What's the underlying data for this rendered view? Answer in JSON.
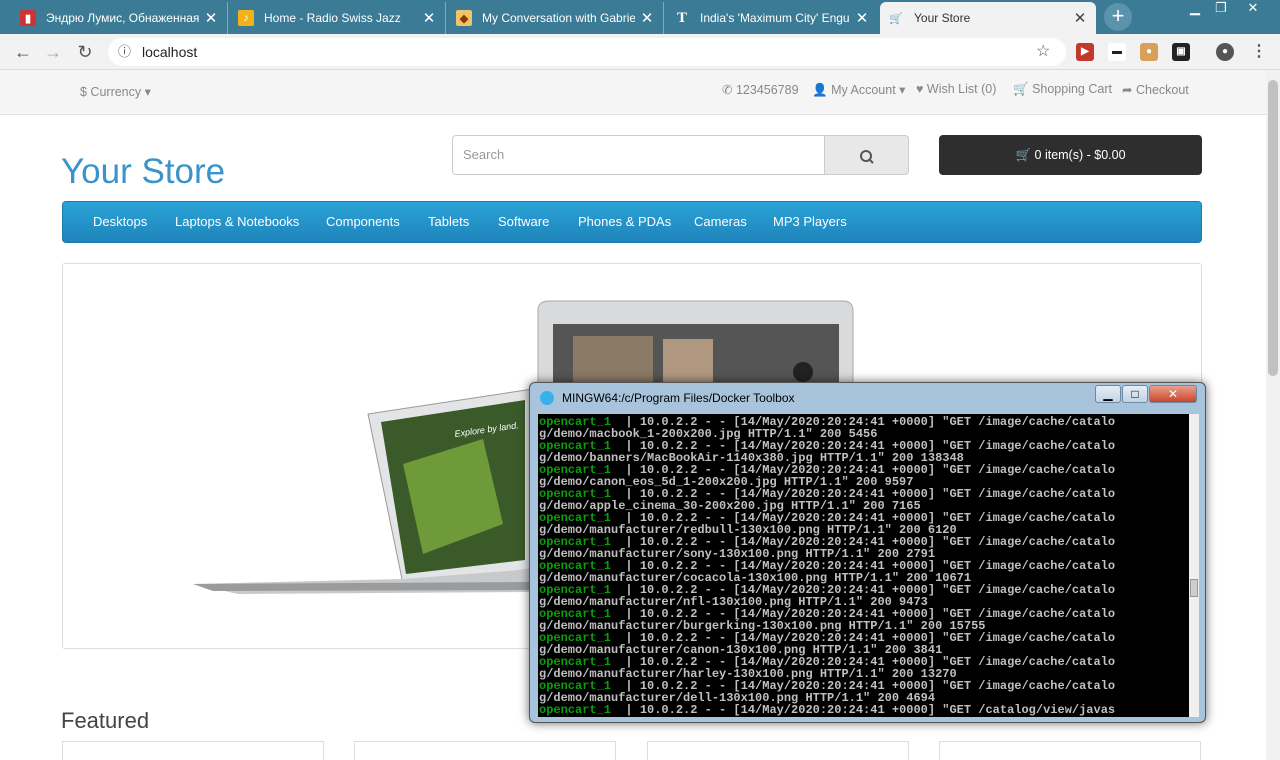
{
  "browser": {
    "tabs": [
      {
        "title": "Эндрю Лумис, Обнаженная",
        "icon": "ru-site-icon"
      },
      {
        "title": "Home - Radio Swiss Jazz",
        "icon": "radio-jazz-icon"
      },
      {
        "title": "My Conversation with Gabrie",
        "icon": "conversation-icon"
      },
      {
        "title": "India's 'Maximum City' Engul",
        "icon": "nyt-icon"
      },
      {
        "title": "Your Store",
        "icon": "cart-icon"
      }
    ],
    "address": "localhost",
    "colors": {
      "tab_bar": "#3c7b95"
    }
  },
  "store": {
    "top": {
      "currency": "$ Currency",
      "phone": "123456789",
      "account": "My Account",
      "wishlist": "Wish List (0)",
      "cart": "Shopping Cart",
      "checkout": "Checkout"
    },
    "logo": "Your Store",
    "search_placeholder": "Search",
    "cart_button": "0 item(s) - $0.00",
    "menu": [
      "Desktops",
      "Laptops & Notebooks",
      "Components",
      "Tablets",
      "Software",
      "Phones & PDAs",
      "Cameras",
      "MP3 Players"
    ],
    "slide_text": "Explore by land.",
    "featured": "Featured",
    "colors": {
      "accent": "#3a94c9",
      "menu": "#229ad0"
    }
  },
  "terminal": {
    "title": "MINGW64:/c/Program Files/Docker Toolbox",
    "lines": [
      {
        "text": "opencart_1  | 10.0.2.2 - - [14/May/2020:20:24:41 +0000] \"GET /image/cache/catalo",
        "prefix": "opencart_1"
      },
      {
        "text": "g/demo/macbook_1-200x200.jpg HTTP/1.1\" 200 5456",
        "prefix": ""
      },
      {
        "text": "opencart_1  | 10.0.2.2 - - [14/May/2020:20:24:41 +0000] \"GET /image/cache/catalo",
        "prefix": "opencart_1"
      },
      {
        "text": "g/demo/banners/MacBookAir-1140x380.jpg HTTP/1.1\" 200 138348",
        "prefix": ""
      },
      {
        "text": "opencart_1  | 10.0.2.2 - - [14/May/2020:20:24:41 +0000] \"GET /image/cache/catalo",
        "prefix": "opencart_1"
      },
      {
        "text": "g/demo/canon_eos_5d_1-200x200.jpg HTTP/1.1\" 200 9597",
        "prefix": ""
      },
      {
        "text": "opencart_1  | 10.0.2.2 - - [14/May/2020:20:24:41 +0000] \"GET /image/cache/catalo",
        "prefix": "opencart_1"
      },
      {
        "text": "g/demo/apple_cinema_30-200x200.jpg HTTP/1.1\" 200 7165",
        "prefix": ""
      },
      {
        "text": "opencart_1  | 10.0.2.2 - - [14/May/2020:20:24:41 +0000] \"GET /image/cache/catalo",
        "prefix": "opencart_1"
      },
      {
        "text": "g/demo/manufacturer/redbull-130x100.png HTTP/1.1\" 200 6120",
        "prefix": ""
      },
      {
        "text": "opencart_1  | 10.0.2.2 - - [14/May/2020:20:24:41 +0000] \"GET /image/cache/catalo",
        "prefix": "opencart_1"
      },
      {
        "text": "g/demo/manufacturer/sony-130x100.png HTTP/1.1\" 200 2791",
        "prefix": ""
      },
      {
        "text": "opencart_1  | 10.0.2.2 - - [14/May/2020:20:24:41 +0000] \"GET /image/cache/catalo",
        "prefix": "opencart_1"
      },
      {
        "text": "g/demo/manufacturer/cocacola-130x100.png HTTP/1.1\" 200 10671",
        "prefix": ""
      },
      {
        "text": "opencart_1  | 10.0.2.2 - - [14/May/2020:20:24:41 +0000] \"GET /image/cache/catalo",
        "prefix": "opencart_1"
      },
      {
        "text": "g/demo/manufacturer/nfl-130x100.png HTTP/1.1\" 200 9473",
        "prefix": ""
      },
      {
        "text": "opencart_1  | 10.0.2.2 - - [14/May/2020:20:24:41 +0000] \"GET /image/cache/catalo",
        "prefix": "opencart_1"
      },
      {
        "text": "g/demo/manufacturer/burgerking-130x100.png HTTP/1.1\" 200 15755",
        "prefix": ""
      },
      {
        "text": "opencart_1  | 10.0.2.2 - - [14/May/2020:20:24:41 +0000] \"GET /image/cache/catalo",
        "prefix": "opencart_1"
      },
      {
        "text": "g/demo/manufacturer/canon-130x100.png HTTP/1.1\" 200 3841",
        "prefix": ""
      },
      {
        "text": "opencart_1  | 10.0.2.2 - - [14/May/2020:20:24:41 +0000] \"GET /image/cache/catalo",
        "prefix": "opencart_1"
      },
      {
        "text": "g/demo/manufacturer/harley-130x100.png HTTP/1.1\" 200 13270",
        "prefix": ""
      },
      {
        "text": "opencart_1  | 10.0.2.2 - - [14/May/2020:20:24:41 +0000] \"GET /image/cache/catalo",
        "prefix": "opencart_1"
      },
      {
        "text": "g/demo/manufacturer/dell-130x100.png HTTP/1.1\" 200 4694",
        "prefix": ""
      },
      {
        "text": "opencart_1  | 10.0.2.2 - - [14/May/2020:20:24:41 +0000] \"GET /catalog/view/javas",
        "prefix": "opencart_1"
      }
    ],
    "colors": {
      "background": "#000000",
      "text": "#c0c0c0",
      "prefix": "#0a9e0a"
    }
  }
}
